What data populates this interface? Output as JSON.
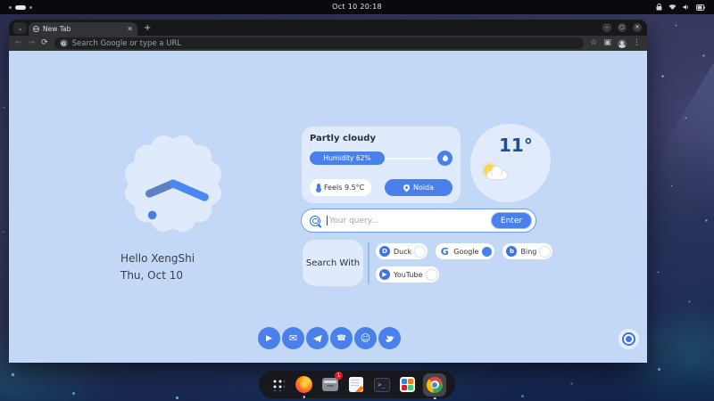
{
  "topbar": {
    "clock": "Oct 10 20:18",
    "status_icons": [
      "lock-icon",
      "wifi-icon",
      "volume-icon",
      "battery-icon"
    ]
  },
  "browser": {
    "tab_title": "New Tab",
    "url_placeholder": "Search Google or type a URL",
    "google_badge": "G"
  },
  "newtab": {
    "greeting": "Hello XengShi",
    "date": "Thu, Oct 10",
    "weather": {
      "condition": "Partly cloudy",
      "humidity": "Humidity 62%",
      "humidity_pct": 62,
      "feels_like": "Feels 9.5°C",
      "city": "Noida",
      "temperature": "11°"
    },
    "search": {
      "placeholder": "Your query...",
      "enter_label": "Enter",
      "with_label": "Search With",
      "engines": [
        {
          "label": "Duck",
          "selected": false,
          "icon": "duckduckgo-icon",
          "glyph": "D"
        },
        {
          "label": "Google",
          "selected": true,
          "icon": "google-icon",
          "glyph": "G"
        },
        {
          "label": "Bing",
          "selected": false,
          "icon": "bing-icon",
          "glyph": "b"
        },
        {
          "label": "YouTube",
          "selected": false,
          "icon": "youtube-icon",
          "glyph": "▶"
        }
      ]
    },
    "shortcut_icons": [
      "youtube-icon",
      "mail-icon",
      "telegram-icon",
      "whatsapp-icon",
      "reddit-icon",
      "twitter-icon"
    ]
  },
  "dock": {
    "apps": [
      "app-grid",
      "firefox",
      "archive-manager",
      "text-editor",
      "terminal",
      "software",
      "chrome"
    ],
    "notification_badge": "1"
  },
  "colors": {
    "accent": "#4a80ea",
    "page_bg": "#c3d8f7",
    "card_bg": "#dfeafc",
    "temp_text": "#1c4e9e"
  }
}
